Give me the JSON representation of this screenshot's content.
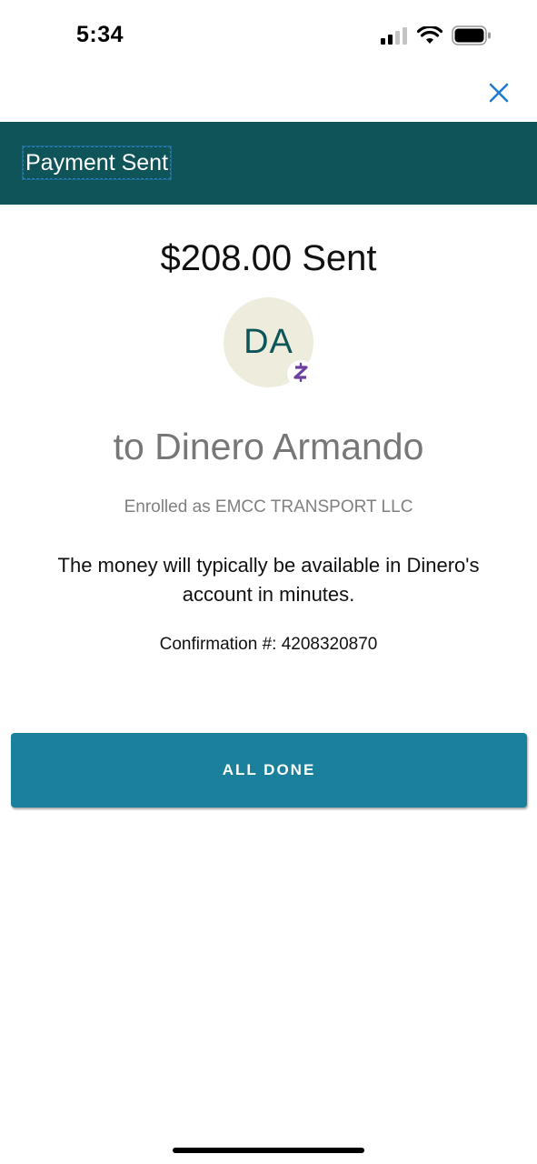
{
  "status_bar": {
    "time": "5:34",
    "signal_icon": "cellular-signal-icon",
    "wifi_icon": "wifi-icon",
    "battery_icon": "battery-icon"
  },
  "nav": {
    "close_icon": "close-icon"
  },
  "header": {
    "title": "Payment Sent"
  },
  "payment": {
    "amount_title": "$208.00 Sent",
    "avatar_initials": "DA",
    "badge_icon": "zelle-icon",
    "recipient": "to Dinero Armando",
    "enrolled_as": "Enrolled as EMCC TRANSPORT LLC",
    "availability_message": "The money will typically be available in Dinero's account in minutes.",
    "confirmation": "Confirmation #: 4208320870"
  },
  "actions": {
    "done_label": "ALL DONE"
  },
  "colors": {
    "header_bg": "#0e5459",
    "button_bg": "#1a809c",
    "avatar_bg": "#eeecdc",
    "zelle_purple": "#6b3fa0",
    "close_blue": "#1f7ad1"
  }
}
